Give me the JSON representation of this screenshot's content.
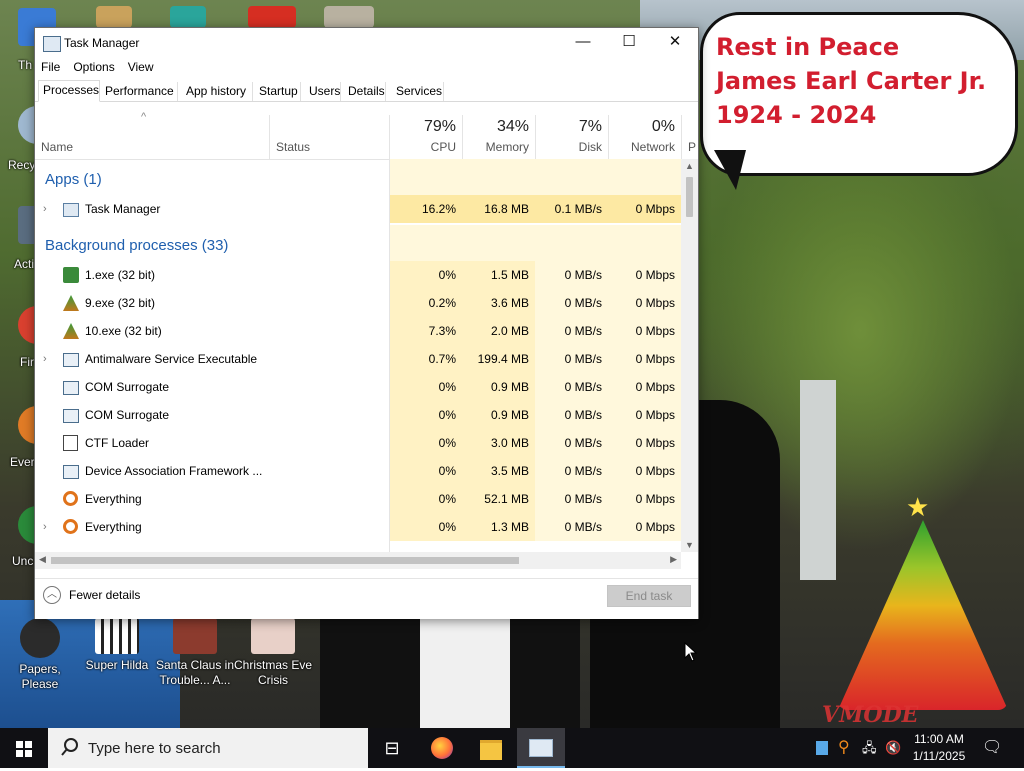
{
  "window": {
    "title": "Task Manager",
    "controls": {
      "minimize": "—",
      "maximize": "☐",
      "close": "✕"
    }
  },
  "menu": [
    "File",
    "Options",
    "View"
  ],
  "tabs": [
    "Processes",
    "Performance",
    "App history",
    "Startup",
    "Users",
    "Details",
    "Services"
  ],
  "active_tab": "Processes",
  "columns": {
    "name": "Name",
    "status": "Status",
    "cpu": {
      "pct": "79%",
      "label": "CPU"
    },
    "memory": {
      "pct": "34%",
      "label": "Memory"
    },
    "disk": {
      "pct": "7%",
      "label": "Disk"
    },
    "network": {
      "pct": "0%",
      "label": "Network"
    },
    "next_partial": "P"
  },
  "groups": {
    "apps": "Apps (1)",
    "background": "Background processes (33)"
  },
  "app_rows": [
    {
      "name": "Task Manager",
      "cpu": "16.2%",
      "memory": "16.8 MB",
      "disk": "0.1 MB/s",
      "network": "0 Mbps",
      "expandable": true,
      "icon": "task-manager-icon"
    }
  ],
  "bg_rows": [
    {
      "name": "1.exe (32 bit)",
      "cpu": "0%",
      "memory": "1.5 MB",
      "disk": "0 MB/s",
      "network": "0 Mbps",
      "expandable": false,
      "icon": "game-icon"
    },
    {
      "name": "9.exe (32 bit)",
      "cpu": "0.2%",
      "memory": "3.6 MB",
      "disk": "0 MB/s",
      "network": "0 Mbps",
      "expandable": false,
      "icon": "tree-icon"
    },
    {
      "name": "10.exe (32 bit)",
      "cpu": "7.3%",
      "memory": "2.0 MB",
      "disk": "0 MB/s",
      "network": "0 Mbps",
      "expandable": false,
      "icon": "tree-icon"
    },
    {
      "name": "Antimalware Service Executable",
      "cpu": "0.7%",
      "memory": "199.4 MB",
      "disk": "0 MB/s",
      "network": "0 Mbps",
      "expandable": true,
      "icon": "service-icon"
    },
    {
      "name": "COM Surrogate",
      "cpu": "0%",
      "memory": "0.9 MB",
      "disk": "0 MB/s",
      "network": "0 Mbps",
      "expandable": false,
      "icon": "service-icon"
    },
    {
      "name": "COM Surrogate",
      "cpu": "0%",
      "memory": "0.9 MB",
      "disk": "0 MB/s",
      "network": "0 Mbps",
      "expandable": false,
      "icon": "service-icon"
    },
    {
      "name": "CTF Loader",
      "cpu": "0%",
      "memory": "3.0 MB",
      "disk": "0 MB/s",
      "network": "0 Mbps",
      "expandable": false,
      "icon": "ctf-icon"
    },
    {
      "name": "Device Association Framework ...",
      "cpu": "0%",
      "memory": "3.5 MB",
      "disk": "0 MB/s",
      "network": "0 Mbps",
      "expandable": false,
      "icon": "service-icon"
    },
    {
      "name": "Everything",
      "cpu": "0%",
      "memory": "52.1 MB",
      "disk": "0 MB/s",
      "network": "0 Mbps",
      "expandable": false,
      "icon": "magnifier-icon"
    },
    {
      "name": "Everything",
      "cpu": "0%",
      "memory": "1.3 MB",
      "disk": "0 MB/s",
      "network": "0 Mbps",
      "expandable": true,
      "icon": "magnifier-icon"
    }
  ],
  "footer": {
    "fewer_details": "Fewer details",
    "end_task": "End task"
  },
  "bubble": {
    "line1": "Rest in Peace",
    "line2": "James Earl Carter Jr.",
    "line3": "1924 - 2024"
  },
  "watermark": "VMODE",
  "left_icon_labels": [
    "Th",
    "Recy",
    "Acti",
    "Fir",
    "Ever",
    "Unc"
  ],
  "bottom_icons": [
    {
      "label": "Papers, Please"
    },
    {
      "label": "Super Hilda"
    },
    {
      "label": "Santa Claus in Trouble... A..."
    },
    {
      "label": "Christmas Eve Crisis"
    }
  ],
  "taskbar": {
    "search_placeholder": "Type here to search",
    "time": "11:00 AM",
    "date": "1/11/2025"
  },
  "colors": {
    "accent_blue": "#1f5fae",
    "heat_high": "#fde9a3",
    "heat_mid": "#fff2c4",
    "heat_low": "#fff8dc",
    "bubble_text": "#d21e2f"
  }
}
